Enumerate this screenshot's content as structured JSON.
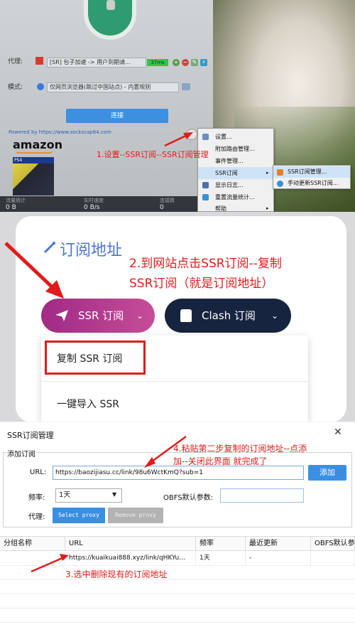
{
  "panel1": {
    "proxy_label": "代理:",
    "proxy_value": "[SR] 包子加速 -> 用户到期请...",
    "proxy_ping": "37ms",
    "mode_label": "模式:",
    "mode_value": "仅网页浏览器(跳过中国站点) - 内置规则",
    "connect_label": "连接",
    "powered_by": "Powered by https://www.sockscap64.com",
    "ad_brand": "amazon",
    "stats": [
      {
        "label": "流量统计",
        "value": "0 B"
      },
      {
        "label": "实时速度",
        "value": "0 B/s"
      },
      {
        "label": "连接数",
        "value": "0"
      }
    ],
    "annotation": "1.设置--SSR订阅--SSR订阅管理",
    "menu_items": [
      "设置...",
      "附加路由管理...",
      "事件管理...",
      "SSR订阅",
      "显示日志...",
      "重置流量统计...",
      "帮助"
    ],
    "submenu_items": [
      "SSR订阅管理...",
      "手动更新SSR订阅..."
    ]
  },
  "panel2": {
    "title": "订阅地址",
    "annotation_line1": "2.到网站点击SSR订阅--复制",
    "annotation_line2": "SSR订阅（就是订阅地址）",
    "ssr_button": "SSR 订阅",
    "clash_button": "Clash 订阅",
    "dropdown_items": [
      "复制 SSR 订阅",
      "一键导入 SSR"
    ]
  },
  "panel3": {
    "window_title": "SSR订阅管理",
    "close": "✕",
    "group_title": "添加订阅",
    "url_label": "URL:",
    "url_value": "https://baozijiasu.cc/link/98u6WctKmQ?sub=1",
    "add_button": "添加",
    "freq_label": "频率:",
    "freq_value": "1天",
    "obfs_label": "OBFS默认参数:",
    "proxy_label": "代理:",
    "select_proxy": "Select proxy",
    "remove_proxy": "Remove proxy",
    "annotation_line1": "4.粘贴第二步复制的订阅地址--点添",
    "annotation_line2": "加--关闭此界面   就完成了",
    "table_columns": [
      "分组名称",
      "URL",
      "频率",
      "最近更新",
      "OBFS默认参"
    ],
    "table_rows": [
      [
        "",
        "https://kuaikuai888.xyz/link/qHKYu...",
        "1天",
        "-",
        ""
      ]
    ],
    "annotation3": "3.选中删除现有的订阅地址"
  },
  "colors": {
    "annotation_red": "#e01b1b",
    "ssr_button": "#b03a8e",
    "clash_button": "#17243f",
    "primary_blue": "#3b8fe3"
  }
}
